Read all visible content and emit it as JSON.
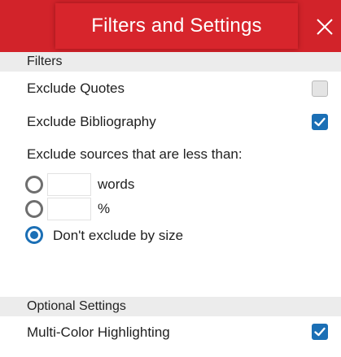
{
  "header": {
    "title": "Filters and Settings",
    "close_icon": "close-icon"
  },
  "filters": {
    "section_title": "Filters",
    "exclude_quotes": {
      "label": "Exclude Quotes",
      "checked": false
    },
    "exclude_bibliography": {
      "label": "Exclude Bibliography",
      "checked": true
    },
    "size_prompt": "Exclude sources that are less than:",
    "size_options": [
      {
        "unit": "words",
        "value": "",
        "selected": false
      },
      {
        "unit": "%",
        "value": "",
        "selected": false
      },
      {
        "label": "Don't exclude by size",
        "selected": true
      }
    ]
  },
  "optional_settings": {
    "section_title": "Optional Settings",
    "multi_color_highlighting": {
      "label": "Multi-Color Highlighting",
      "checked": true
    }
  },
  "colors": {
    "brand_red": "#d2232a",
    "accent_blue": "#1b6fb5"
  }
}
